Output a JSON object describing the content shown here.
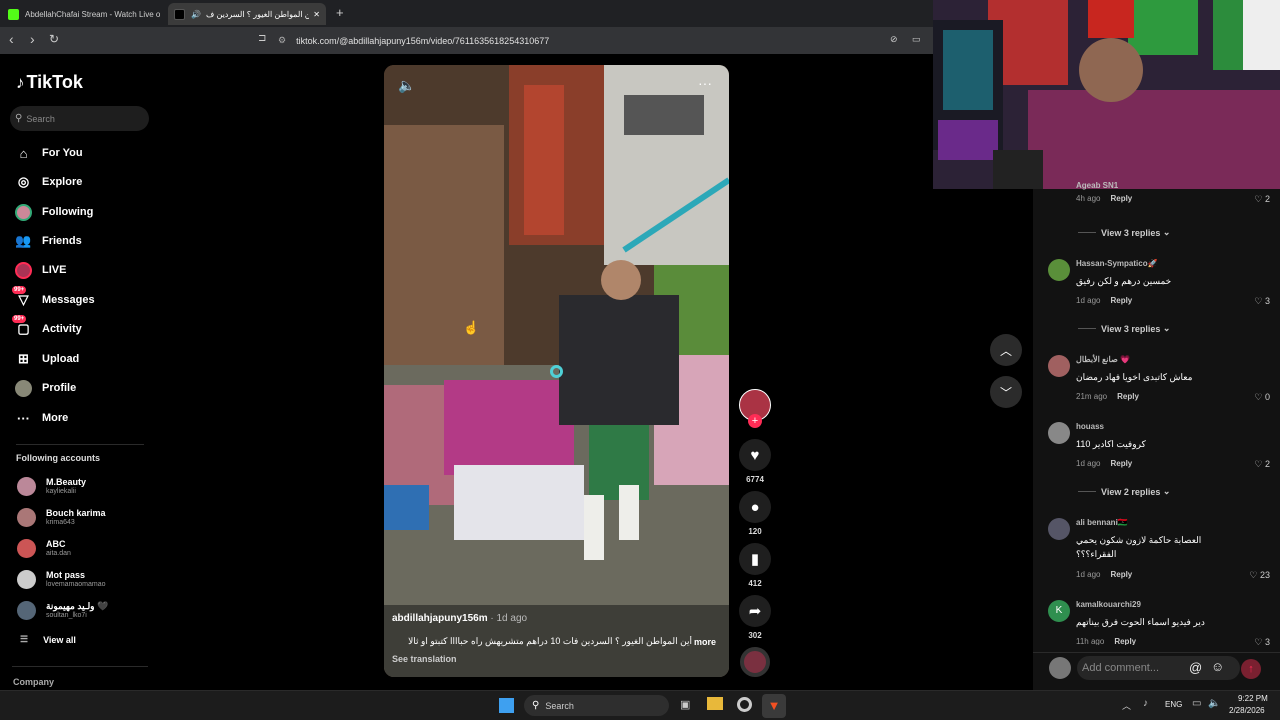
{
  "browser": {
    "tabs": [
      {
        "label": "AbdellahChafai Stream - Watch Live o"
      },
      {
        "label": "أين المواطن الغيور ؟ السردين ف"
      }
    ],
    "new_tab_icon": "+",
    "url": "tiktok.com/@abdillahjapuny156m/video/7611635618254310677"
  },
  "sidebar": {
    "logo": "TikTok",
    "search_placeholder": "Search",
    "nav": [
      {
        "label": "For You",
        "icon": "home-icon"
      },
      {
        "label": "Explore",
        "icon": "compass-icon"
      },
      {
        "label": "Following",
        "icon": "following-avatar"
      },
      {
        "label": "Friends",
        "icon": "friends-icon"
      },
      {
        "label": "LIVE",
        "icon": "live-icon"
      },
      {
        "label": "Messages",
        "icon": "messages-icon",
        "badge": "99+"
      },
      {
        "label": "Activity",
        "icon": "activity-icon",
        "badge": "99+"
      },
      {
        "label": "Upload",
        "icon": "upload-icon"
      },
      {
        "label": "Profile",
        "icon": "profile-avatar"
      },
      {
        "label": "More",
        "icon": "more-icon"
      }
    ],
    "following_title": "Following accounts",
    "accounts": [
      {
        "name": "M.Beauty",
        "handle": "kayliekalii"
      },
      {
        "name": "Bouch karima",
        "handle": "krima643"
      },
      {
        "name": "ABC",
        "handle": "aita.dan"
      },
      {
        "name": "Mot pass",
        "handle": "lovemamaomamao"
      },
      {
        "name": "ولـيد مهيمونة 🖤",
        "handle": "soultan_lko7i"
      }
    ],
    "view_all": "View all",
    "company": "Company"
  },
  "video": {
    "author": "abdillahjapuny156m",
    "time": "1d ago",
    "caption": "أين المواطن الغيور ؟ السردين فات 10 دراهم متشريهش راه حباااا كتبتو او ثالا",
    "more": "more",
    "see_translation": "See translation"
  },
  "actions": {
    "likes": "6774",
    "comments": "120",
    "saves": "412",
    "shares": "302"
  },
  "comments": {
    "top": {
      "partial_user": "Ageab SN1",
      "time": "4h ago",
      "reply": "Reply",
      "likes": "2",
      "replies": "View 3 replies"
    },
    "items": [
      {
        "user": "Hassan-Sympatico🚀",
        "text": "خمسين درهم و لكن رفيق",
        "time": "1d ago",
        "reply": "Reply",
        "likes": "3",
        "replies": "View 3 replies"
      },
      {
        "user": "صانع الأبطال 💗",
        "text": "معاش كاتبدى اخويا فهاد رمضان",
        "time": "21m ago",
        "reply": "Reply",
        "likes": "0"
      },
      {
        "user": "houass",
        "text": "كروفيت اكادير 110",
        "time": "1d ago",
        "reply": "Reply",
        "likes": "2",
        "replies": "View 2 replies"
      },
      {
        "user": "ali bennani🇱🇾",
        "text": "العصابة حاكمة لازون شكون يحمي الفقراء؟؟؟",
        "time": "1d ago",
        "reply": "Reply",
        "likes": "23"
      },
      {
        "user": "kamalkouarchi29",
        "text": "دير فيديو اسماء الحوت فرق بيناتهم",
        "time": "11h ago",
        "reply": "Reply",
        "likes": "3"
      }
    ],
    "input_placeholder": "Add comment...",
    "at_icon": "@"
  },
  "taskbar": {
    "search": "Search",
    "lang": "ENG",
    "time": "9:22 PM",
    "date": "2/28/2026"
  },
  "colors": {
    "accent": "#fe2c55",
    "background": "#000000",
    "panel": "#121212"
  }
}
